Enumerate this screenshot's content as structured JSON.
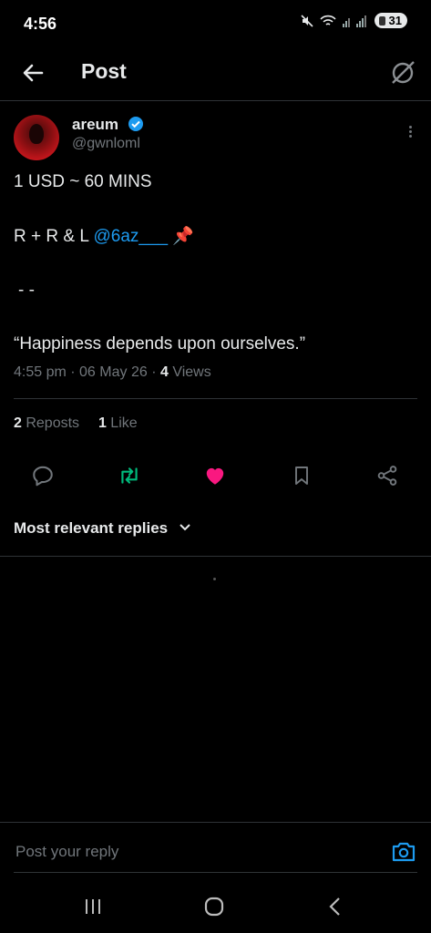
{
  "status_bar": {
    "time": "4:56",
    "battery": "31"
  },
  "header": {
    "title": "Post"
  },
  "author": {
    "name": "areum",
    "handle": "@gwnloml"
  },
  "post": {
    "line1": "1 USD ~ 60 MINS",
    "line2_prefix": "R + R & L ",
    "line2_mention": "@6az___",
    "line2_emoji": "📌",
    "line3": "- -",
    "line4": "“Happiness depends upon ourselves.”"
  },
  "meta": {
    "time": "4:55 pm",
    "sep1": " · ",
    "date": "06 May 26",
    "sep2": " · ",
    "views_count": "4",
    "views_label": " Views"
  },
  "stats": {
    "reposts_count": "2",
    "reposts_label": " Reposts",
    "likes_count": "1",
    "likes_label": " Like"
  },
  "sort": {
    "label": "Most relevant replies"
  },
  "reply": {
    "placeholder": "Post your reply"
  },
  "colors": {
    "accent": "#1d9bf0",
    "like": "#f91880",
    "repost": "#00ba7c",
    "muted": "#71767b"
  },
  "icons": [
    "back-arrow-icon",
    "grok-icon",
    "verified-icon",
    "more-icon",
    "reply-icon",
    "repost-icon",
    "like-icon",
    "bookmark-icon",
    "share-icon",
    "chevron-down-icon",
    "camera-icon",
    "recents-icon",
    "home-icon",
    "back-nav-icon"
  ]
}
